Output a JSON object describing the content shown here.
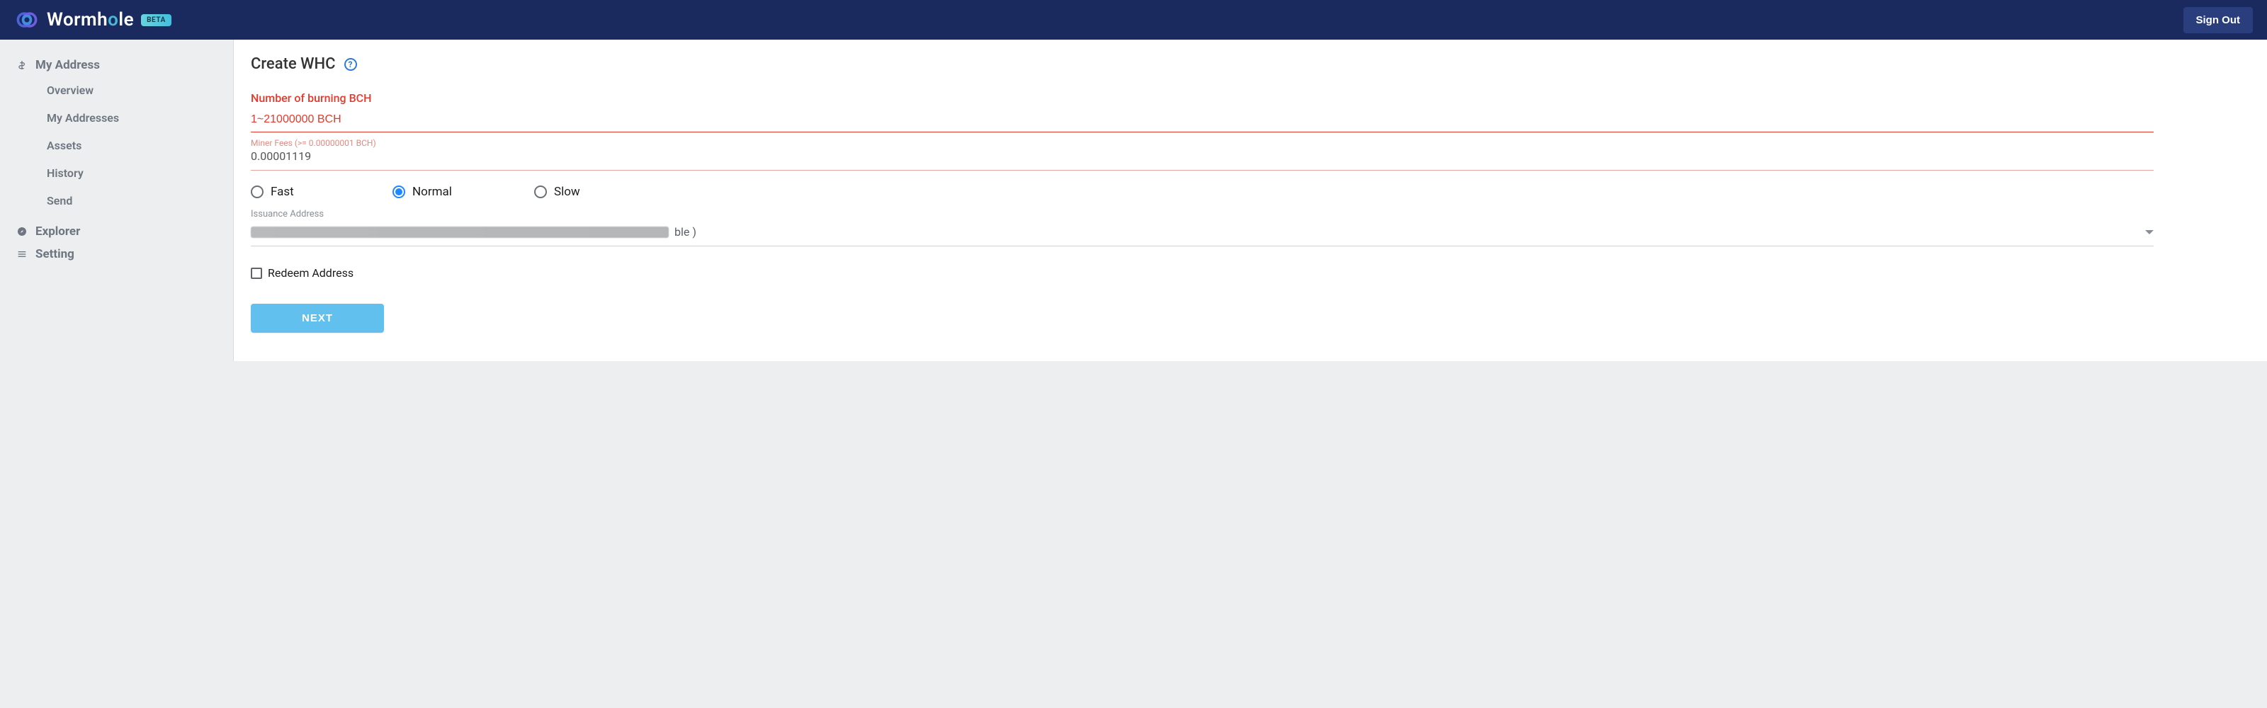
{
  "header": {
    "brand": "Wormhole",
    "beta": "BETA",
    "signout": "Sign Out"
  },
  "sidebar": {
    "my_address": {
      "label": "My Address",
      "items": [
        "Overview",
        "My Addresses",
        "Assets",
        "History",
        "Send"
      ]
    },
    "explorer": "Explorer",
    "setting": "Setting"
  },
  "page": {
    "title": "Create WHC",
    "burning_bch_label": "Number of burning BCH",
    "burning_bch_placeholder": "1~21000000 BCH",
    "miner_fees_helper": "Miner Fees (>= 0.00000001 BCH)",
    "miner_fees_value": "0.00001119",
    "speed_options": {
      "fast": "Fast",
      "normal": "Normal",
      "slow": "Slow"
    },
    "speed_selected": "normal",
    "issuance_label": "Issuance Address",
    "issuance_suffix": "ble )",
    "redeem_label": "Redeem Address",
    "next": "NEXT"
  }
}
